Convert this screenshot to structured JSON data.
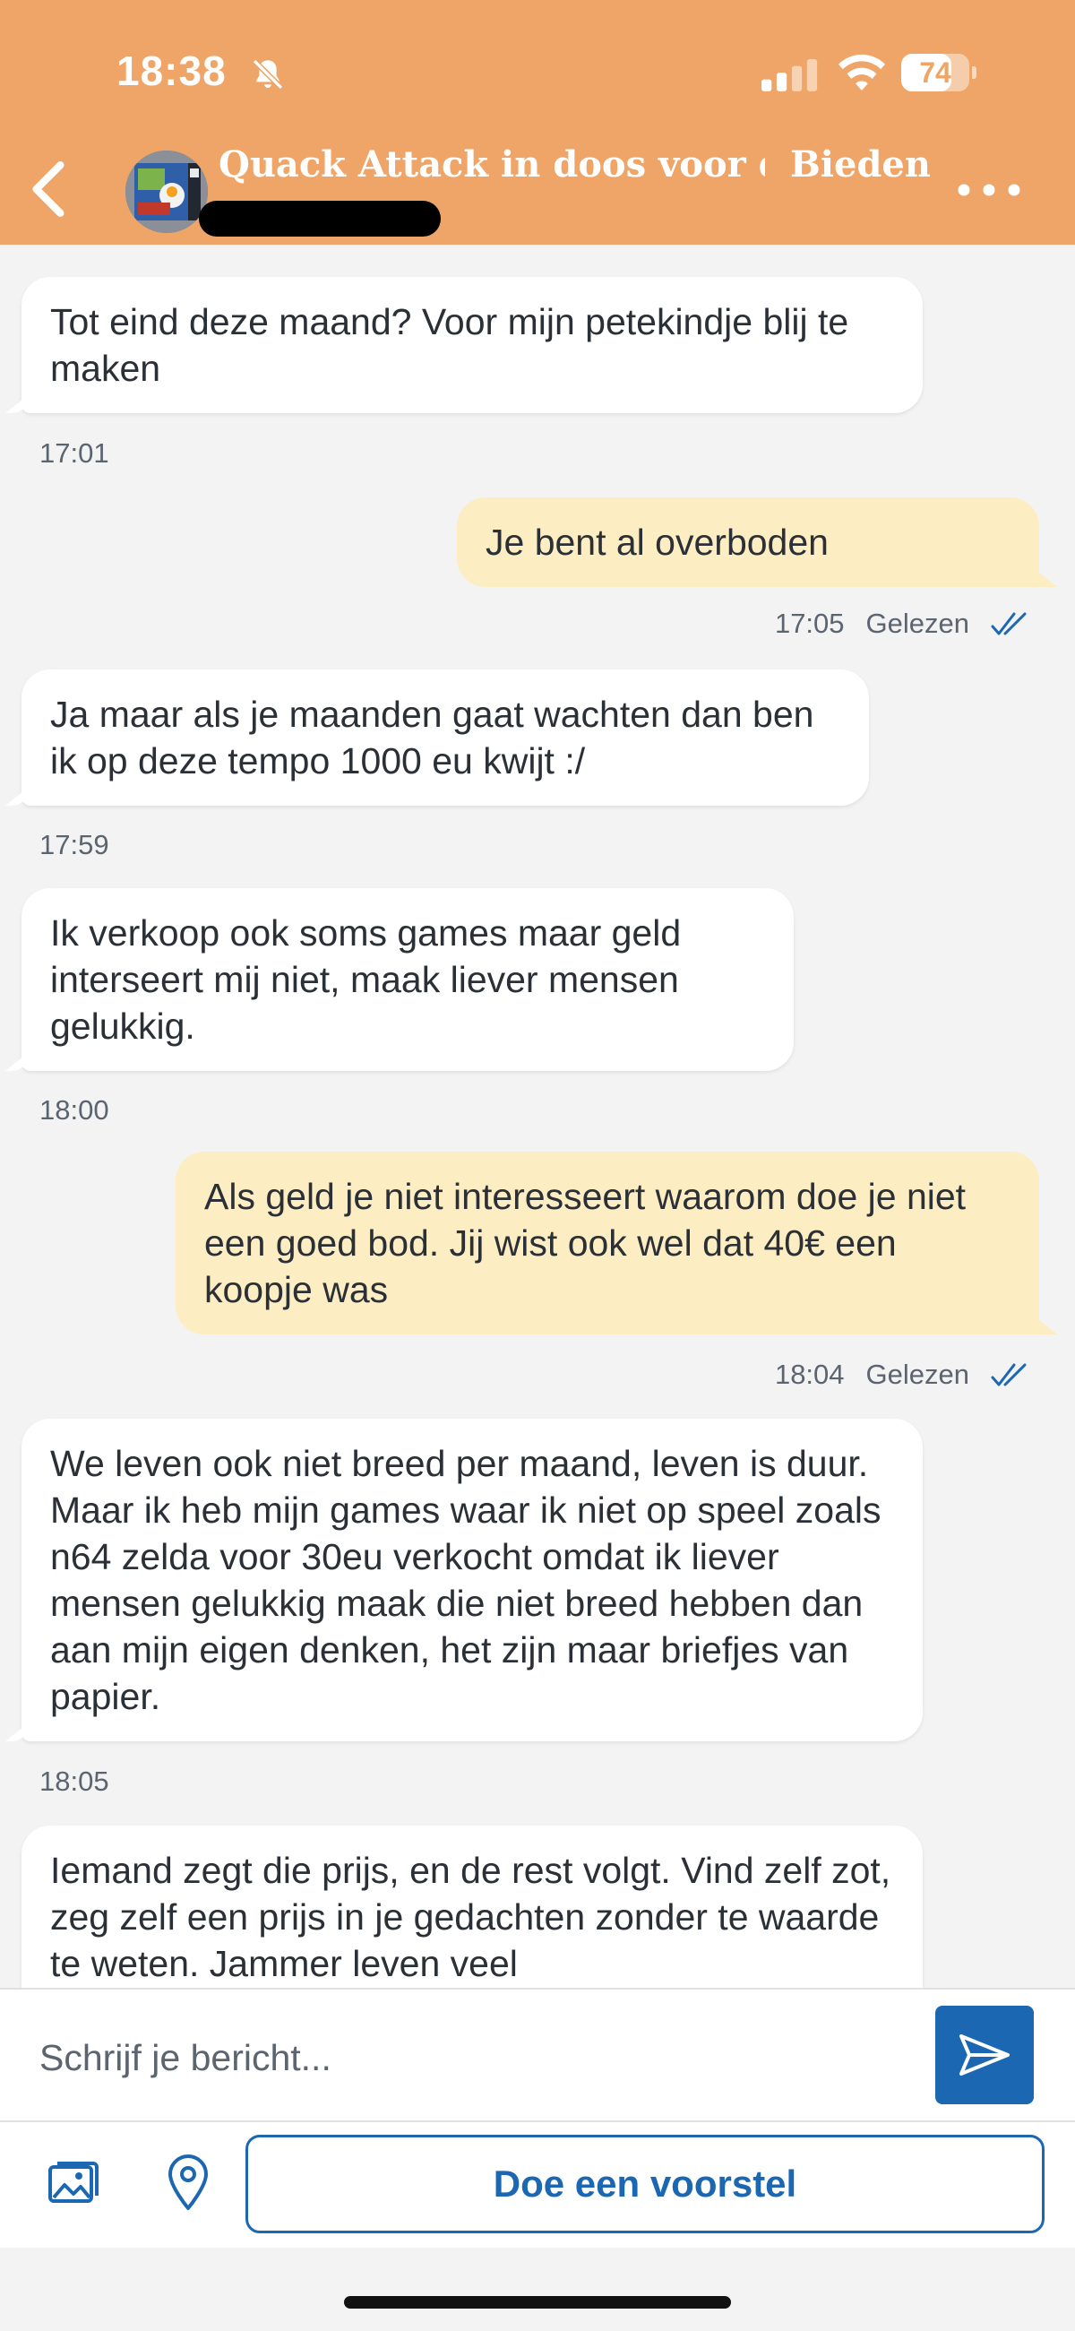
{
  "status_bar": {
    "time": "18:38",
    "battery": "74",
    "battery_level": 0.74,
    "icons": [
      "bell-slash-icon",
      "cellular-signal-icon",
      "wifi-icon",
      "battery-icon"
    ]
  },
  "header": {
    "title": "Quack Attack in doos voor de...",
    "action_label": "Bieden",
    "icons": [
      "chevron-left-icon",
      "product-thumbnail",
      "more-dots-icon"
    ],
    "color": "#eea567"
  },
  "messages": [
    {
      "direction": "in",
      "text": "Tot eind deze maand? Voor mijn petekindje blij te maken",
      "time": "17:01"
    },
    {
      "direction": "out",
      "text": "Je bent al overboden",
      "time": "17:05",
      "status": "Gelezen"
    },
    {
      "direction": "in",
      "text": "Ja maar als je maanden gaat wachten dan ben ik op deze tempo 1000 eu kwijt :/",
      "time": "17:59"
    },
    {
      "direction": "in",
      "text": "Ik verkoop ook soms games maar geld interseert mij niet, maak liever mensen gelukkig.",
      "time": "18:00"
    },
    {
      "direction": "out",
      "text": "Als geld je niet interesseert waarom doe je niet een goed bod. Jij wist ook wel dat 40€ een koopje was",
      "time": "18:04",
      "status": "Gelezen"
    },
    {
      "direction": "in",
      "text": "We leven ook niet breed per maand, leven is duur. Maar ik heb mijn games waar ik niet op speel zoals n64 zelda voor 30eu verkocht omdat ik liever mensen gelukkig maak die niet breed hebben dan aan mijn eigen denken, het zijn maar briefjes van papier.",
      "time": "18:05"
    },
    {
      "direction": "in",
      "text": "Iemand zegt die prijs, en de rest volgt. Vind zelf zot, zeg zelf een prijs in je gedachten zonder te waarde te weten. Jammer leven veel",
      "time": ""
    }
  ],
  "composer": {
    "placeholder": "Schrijf je bericht...",
    "value": ""
  },
  "actions": {
    "offer_label": "Doe een voorstel",
    "icons": [
      "photo-gallery-icon",
      "location-pin-icon",
      "send-icon"
    ]
  },
  "colors": {
    "accent": "#1c67b2",
    "outgoing_bubble": "#fdedc3",
    "incoming_bubble": "#ffffff",
    "background": "#f3f3f3"
  }
}
